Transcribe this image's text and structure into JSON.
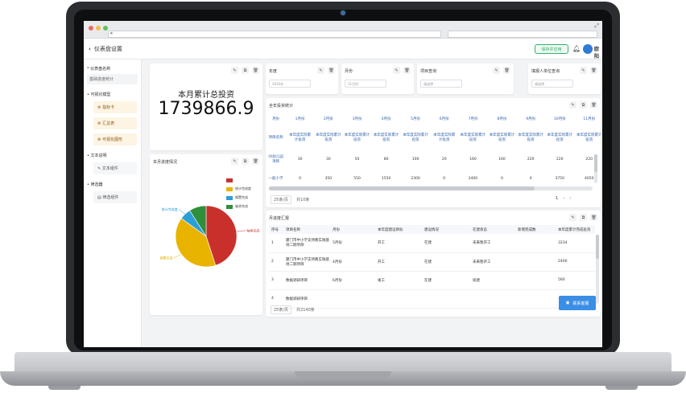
{
  "browser": {
    "url": "",
    "search": ""
  },
  "header": {
    "back_label": "仪表盘设置",
    "save_app_label": "保存并应用",
    "user_name": "欧阳",
    "avatar_text": ""
  },
  "sidebar": {
    "name_label": "* 仪表盘名称",
    "name_value": "基础进度统计",
    "groups": [
      {
        "label": "• 可视化模型",
        "items": [
          "指标卡",
          "汇总表",
          "可视化图形"
        ]
      },
      {
        "label": "• 文本说明",
        "items": [
          "文本组件"
        ]
      },
      {
        "label": "• 筛选器",
        "items": [
          "筛选组件"
        ]
      }
    ]
  },
  "kpi": {
    "title": "本月累计总投资",
    "value": "1739866.9"
  },
  "filters": [
    {
      "label": "年度",
      "placeholder": "2020年"
    },
    {
      "label": "月份",
      "placeholder": "11月份"
    },
    {
      "label": "项目查询",
      "placeholder": "请选择"
    },
    {
      "label": "填报人单位查询",
      "placeholder": "请选择"
    }
  ],
  "pie": {
    "title": "本月进度情况",
    "legend": [
      "",
      "统计完成度",
      "搁置完成",
      "轴承完成"
    ],
    "labels": [
      "轴承完成",
      "搁置完成",
      "统计完成度",
      ""
    ],
    "colors": [
      "#c9302c",
      "#e8b400",
      "#2b9fd9",
      "#2f8f3a"
    ],
    "values": [
      45,
      40,
      6,
      9
    ]
  },
  "annual_table": {
    "title": "全年投资统计",
    "month_header": "月份",
    "months": [
      "1月份",
      "2月份",
      "3月份",
      "4月份",
      "5月份",
      "6月份",
      "7月份",
      "8月份",
      "9月份",
      "10月份",
      "11月份"
    ],
    "name_header": "项目名称",
    "sub_header": "本年度实际累计投资",
    "rows": [
      {
        "name": "IO幼儿园项目",
        "values": [
          "30",
          "30",
          "50",
          "80",
          "100",
          "20",
          "160",
          "160",
          "220",
          "220",
          "220"
        ]
      },
      {
        "name": "一般小学",
        "values": [
          "0",
          "350",
          "550",
          "1550",
          "2300",
          "0",
          "3400",
          "0",
          "0",
          "3750",
          "4050"
        ]
      }
    ],
    "pager": {
      "page_size": "25条/页",
      "total": "共10条",
      "current": "1"
    }
  },
  "progress_table": {
    "title": "月进度汇报",
    "columns": [
      "序号",
      "项目名称",
      "月份",
      "本年度建设目标",
      "建设情况",
      "在建状态",
      "新增完成数",
      "本年度累计完成投资"
    ],
    "rows": [
      [
        "1",
        "厦门市中小学支持教实践基地二期项目",
        "5月份",
        "开工",
        "在建",
        "未来暂开工",
        "",
        "3234"
      ],
      [
        "2",
        "厦门市中小学支持教实践基地二期项目",
        "4月份",
        "开工",
        "在建",
        "未来暂开工",
        "",
        "2400"
      ],
      [
        "3",
        "数据调研项目",
        "6月份",
        "竣工",
        "在建",
        "续建",
        "",
        "560"
      ],
      [
        "4",
        "数据调研项目",
        "",
        "",
        "",
        "",
        "",
        ""
      ]
    ],
    "pager": {
      "page_size": "25条/页",
      "total": "共2140条"
    }
  },
  "contact": {
    "label": "联系客服"
  },
  "tools": {
    "edit": "✎",
    "copy": "⧉",
    "delete": "🗑"
  }
}
